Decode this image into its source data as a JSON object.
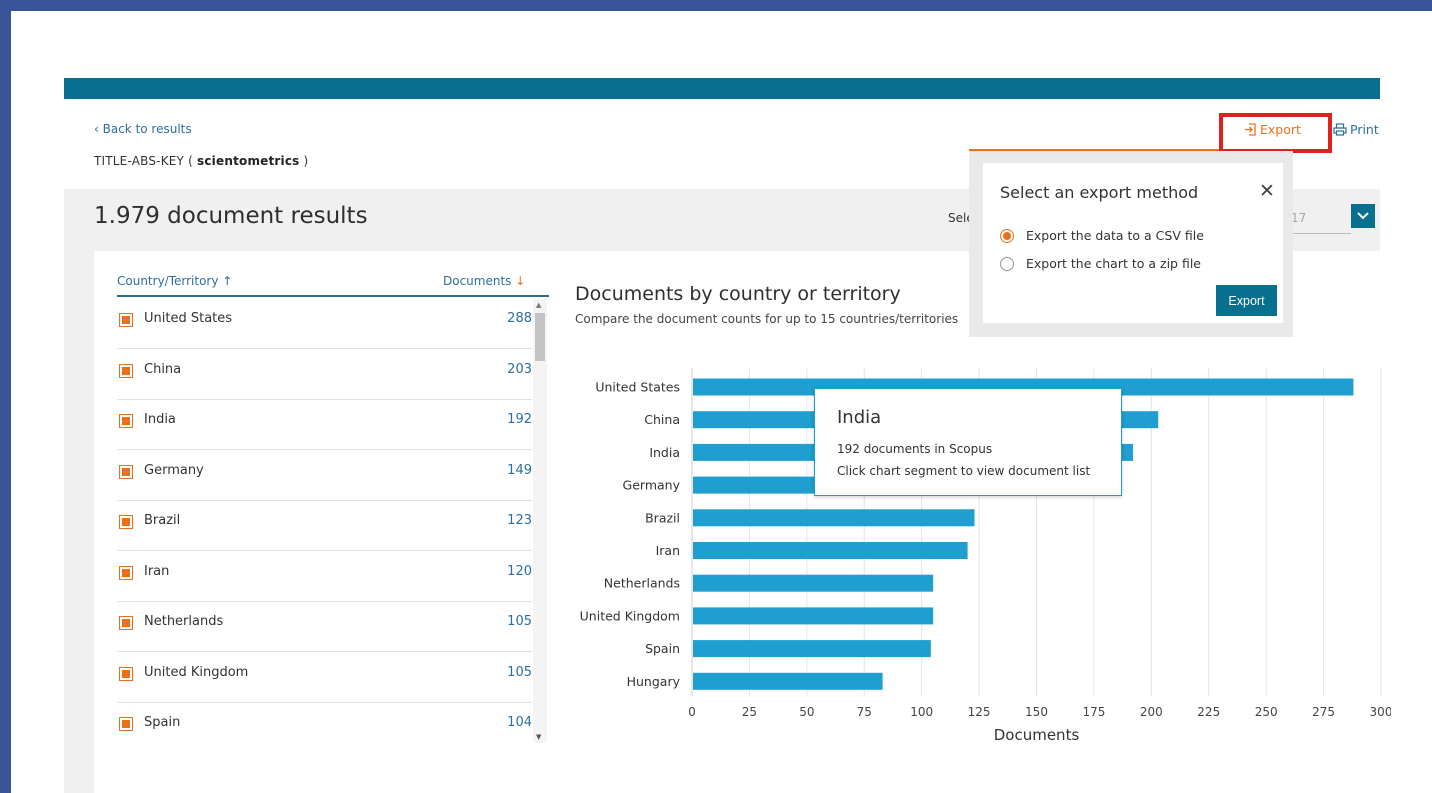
{
  "header": {
    "back_label": "Back to results",
    "query_prefix": "TITLE-ABS-KEY (",
    "query_term": "scientometrics",
    "query_suffix": ")",
    "export_label": "Export",
    "print_label": "Print"
  },
  "results": {
    "title": "1.979 document results",
    "select_label_partial": "Sele",
    "year_partial": "17"
  },
  "table": {
    "col_country": "Country/Territory",
    "col_docs": "Documents",
    "rows": [
      {
        "name": "United States",
        "count": "288"
      },
      {
        "name": "China",
        "count": "203"
      },
      {
        "name": "India",
        "count": "192"
      },
      {
        "name": "Germany",
        "count": "149"
      },
      {
        "name": "Brazil",
        "count": "123"
      },
      {
        "name": "Iran",
        "count": "120"
      },
      {
        "name": "Netherlands",
        "count": "105"
      },
      {
        "name": "United Kingdom",
        "count": "105"
      },
      {
        "name": "Spain",
        "count": "104"
      }
    ]
  },
  "chart": {
    "title": "Documents by country or territory",
    "subtitle": "Compare the document counts for up to 15 countries/territories"
  },
  "chart_data": {
    "type": "bar",
    "orientation": "horizontal",
    "categories": [
      "United States",
      "China",
      "India",
      "Germany",
      "Brazil",
      "Iran",
      "Netherlands",
      "United Kingdom",
      "Spain",
      "Hungary"
    ],
    "values": [
      288,
      203,
      192,
      149,
      123,
      120,
      105,
      105,
      104,
      83
    ],
    "xlabel": "Documents",
    "ylabel": "",
    "xlim": [
      0,
      300
    ],
    "xticks": [
      "0",
      "25",
      "50",
      "75",
      "100",
      "125",
      "150",
      "175",
      "200",
      "225",
      "250",
      "275",
      "300"
    ],
    "grid": "vertical",
    "bar_color": "#1f9fd0"
  },
  "tooltip": {
    "title": "India",
    "line1": "192 documents in Scopus",
    "line2": "Click chart segment to view document list"
  },
  "export_popup": {
    "title": "Select an export method",
    "option_csv": "Export the data to a CSV file",
    "option_zip": "Export the chart to a zip file",
    "selected": "csv",
    "button_label": "Export"
  },
  "colors": {
    "brand": "#07708f",
    "accent": "#e9711c",
    "highlight": "#e0221d",
    "link": "#2a6fa3"
  }
}
